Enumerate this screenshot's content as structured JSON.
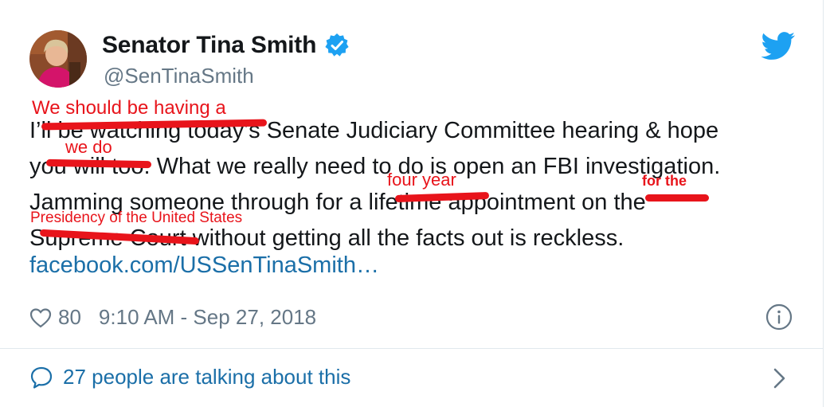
{
  "author": {
    "name": "Senator Tina Smith",
    "handle": "@SenTinaSmith",
    "verified": true
  },
  "tweet": {
    "lines": [
      "I’ll be watching today’s Senate Judiciary Committee hearing & hope",
      "you will too. What we really need to do is open an FBI investigation.",
      "Jamming someone through for a lifetime appointment on the",
      "Supreme Court without getting all the facts out is reckless."
    ],
    "link": "facebook.com/USSenTinaSmith…"
  },
  "annotations": [
    "We should be having a",
    "we do",
    "four year",
    "for the",
    "Presidency of the United States"
  ],
  "meta": {
    "likes": "80",
    "timestamp": "9:10 AM - Sep 27, 2018"
  },
  "footer": {
    "talking": "27 people are talking about this"
  },
  "colors": {
    "link": "#1b6fa8",
    "annotation": "#e8141b",
    "twitter_blue": "#1da1f2",
    "muted": "#657786"
  },
  "icons": [
    "verified-badge-icon",
    "twitter-bird-icon",
    "heart-icon",
    "info-icon",
    "speech-bubble-icon",
    "chevron-right-icon"
  ]
}
